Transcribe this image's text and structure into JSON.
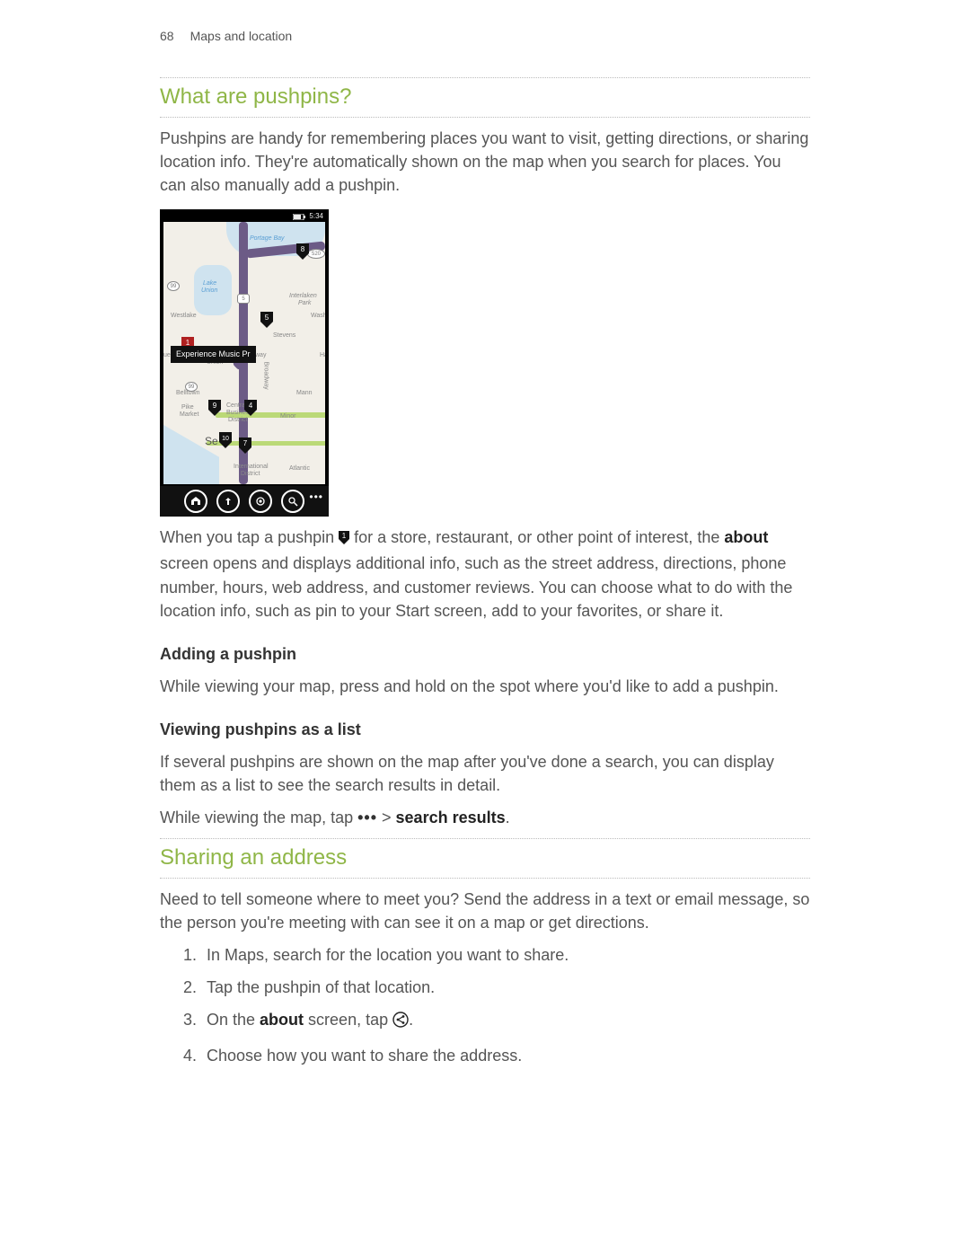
{
  "header": {
    "page_number": "68",
    "breadcrumb": "Maps and location"
  },
  "section1": {
    "heading": "What are pushpins?",
    "intro": "Pushpins are handy for remembering places you want to visit, getting directions, or sharing location info. They're automatically shown on the map when you search for places. You can also manually add a pushpin.",
    "para2_a": "When you tap a pushpin ",
    "para2_b": " for a store, restaurant, or other point of interest, the ",
    "para2_about": "about",
    "para2_c": " screen opens and displays additional info, such as the street address, directions, phone number, hours, web address, and customer reviews. You can choose what to do with the location info, such as pin to your Start screen, add to your favorites, or share it.",
    "sub_add": "Adding a pushpin",
    "add_body": "While viewing your map, press and hold on the spot where you'd like to add a pushpin.",
    "sub_list": "Viewing pushpins as a list",
    "list_body": "If several pushpins are shown on the map after you've done a search, you can display them as a list to see the search results in detail.",
    "list_tap_a": "While viewing the map, tap ",
    "list_tap_more": "•••",
    "list_tap_sep": " > ",
    "list_tap_target": "search results",
    "list_tap_period": "."
  },
  "section2": {
    "heading": "Sharing an address",
    "intro": "Need to tell someone where to meet you? Send the address in a text or email message, so the person you're meeting with can see it on a map or get directions.",
    "steps": {
      "s1": "In Maps, search for the location you want to share.",
      "s2": "Tap the pushpin of that location.",
      "s3a": "On the ",
      "s3about": "about",
      "s3b": " screen, tap ",
      "s3c": ".",
      "s4": "Choose how you want to share the address."
    }
  },
  "screenshot": {
    "status_time": "5:34",
    "tooltip": "Experience Music Pr",
    "pin_labels": {
      "p1": "1",
      "p4": "4",
      "p5": "5",
      "p7": "7",
      "p8": "8",
      "p9": "9",
      "p10": "10"
    },
    "map_labels": {
      "portage": "Portage Bay",
      "lake_union1": "Lake",
      "lake_union2": "Union",
      "westlake": "Westlake",
      "stevens": "Stevens",
      "union": "Union",
      "belltown": "Belltown",
      "pike1": "Pike",
      "pike2": "Market",
      "central1": "Central",
      "central2": "Business",
      "central3": "District",
      "intl1": "International",
      "intl2": "District",
      "minor": "Minor",
      "mann": "Mann",
      "atlantic": "Atlantic",
      "way": "way",
      "broad": "Broadway",
      "interlaken1": "Interlaken",
      "interlaken2": "Park",
      "washi": "Washi",
      "se": "Se",
      "le": "le",
      "ha": "Ha",
      "seen": "ueen"
    },
    "shields": {
      "s99a": "99",
      "s99b": "99",
      "s5": "5",
      "s520": "520"
    }
  }
}
